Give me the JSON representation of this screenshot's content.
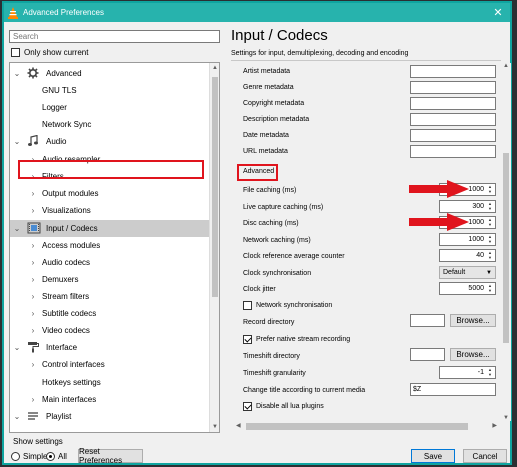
{
  "window": {
    "title": "Advanced Preferences",
    "close_glyph": "✕"
  },
  "left": {
    "search_placeholder": "Search",
    "only_show_current": "Only show current",
    "tree": [
      {
        "label": "Advanced",
        "icon": "gear-icon",
        "level": 0,
        "expanded": true
      },
      {
        "label": "GNU TLS",
        "level": 1
      },
      {
        "label": "Logger",
        "level": 1
      },
      {
        "label": "Network Sync",
        "level": 1
      },
      {
        "label": "Audio",
        "icon": "music-note-icon",
        "level": 0,
        "expanded": true
      },
      {
        "label": "Audio resampler",
        "level": 1,
        "has_children": true
      },
      {
        "label": "Filters",
        "level": 1,
        "has_children": true
      },
      {
        "label": "Output modules",
        "level": 1,
        "has_children": true
      },
      {
        "label": "Visualizations",
        "level": 1,
        "has_children": true
      },
      {
        "label": "Input / Codecs",
        "icon": "film-icon",
        "level": 0,
        "expanded": true,
        "selected": true
      },
      {
        "label": "Access modules",
        "level": 1,
        "has_children": true
      },
      {
        "label": "Audio codecs",
        "level": 1,
        "has_children": true
      },
      {
        "label": "Demuxers",
        "level": 1,
        "has_children": true
      },
      {
        "label": "Stream filters",
        "level": 1,
        "has_children": true
      },
      {
        "label": "Subtitle codecs",
        "level": 1,
        "has_children": true
      },
      {
        "label": "Video codecs",
        "level": 1,
        "has_children": true
      },
      {
        "label": "Interface",
        "icon": "paint-roller-icon",
        "level": 0,
        "expanded": true
      },
      {
        "label": "Control interfaces",
        "level": 1,
        "has_children": true
      },
      {
        "label": "Hotkeys settings",
        "level": 1
      },
      {
        "label": "Main interfaces",
        "level": 1,
        "has_children": true
      },
      {
        "label": "Playlist",
        "icon": "playlist-icon",
        "level": 0,
        "expanded": true
      }
    ],
    "show_settings": "Show settings",
    "simple": "Simple",
    "all": "All",
    "reset": "Reset Preferences"
  },
  "right": {
    "title": "Input / Codecs",
    "subtitle": "Settings for input, demultiplexing, decoding and encoding",
    "metadata": [
      {
        "label": "Artist metadata",
        "value": ""
      },
      {
        "label": "Genre metadata",
        "value": ""
      },
      {
        "label": "Copyright metadata",
        "value": ""
      },
      {
        "label": "Description metadata",
        "value": ""
      },
      {
        "label": "Date metadata",
        "value": ""
      },
      {
        "label": "URL metadata",
        "value": ""
      }
    ],
    "advanced_header": "Advanced",
    "file_caching": {
      "label": "File caching (ms)",
      "value": "1000"
    },
    "live_caching": {
      "label": "Live capture caching (ms)",
      "value": "300"
    },
    "disc_caching": {
      "label": "Disc caching (ms)",
      "value": "1000"
    },
    "network_caching": {
      "label": "Network caching (ms)",
      "value": "1000"
    },
    "clock_ref": {
      "label": "Clock reference average counter",
      "value": "40"
    },
    "clock_sync": {
      "label": "Clock synchronisation",
      "value": "Default"
    },
    "clock_jitter": {
      "label": "Clock jitter",
      "value": "5000"
    },
    "network_sync": {
      "label": "Network synchronisation",
      "checked": false
    },
    "record_dir": {
      "label": "Record directory",
      "value": "",
      "browse": "Browse..."
    },
    "prefer_native": {
      "label": "Prefer native stream recording",
      "checked": true
    },
    "timeshift_dir": {
      "label": "Timeshift directory",
      "value": "",
      "browse": "Browse..."
    },
    "timeshift_gran": {
      "label": "Timeshift granularity",
      "value": "-1"
    },
    "change_title": {
      "label": "Change title according to current media",
      "value": "$Z"
    },
    "disable_lua": {
      "label": "Disable all lua plugins",
      "checked": true
    }
  },
  "buttons": {
    "save": "Save",
    "cancel": "Cancel"
  },
  "colors": {
    "accent": "#27b3ad",
    "highlight": "#e0141d"
  }
}
